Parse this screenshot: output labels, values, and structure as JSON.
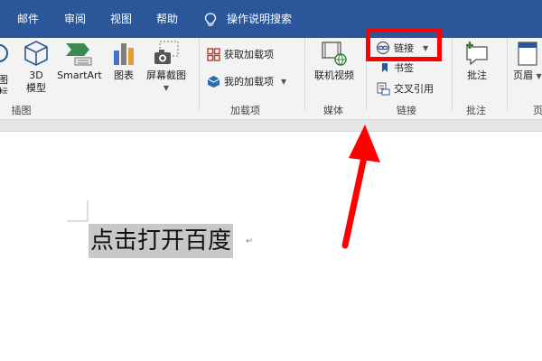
{
  "tabs": [
    {
      "label": "邮件"
    },
    {
      "label": "审阅"
    },
    {
      "label": "视图"
    },
    {
      "label": "帮助"
    }
  ],
  "search": {
    "label": "操作说明搜索"
  },
  "ribbon": {
    "illustrations": {
      "partial_label_top": "图",
      "partial_label_bottom": "标",
      "model3d": "3D\n模型",
      "smartart": "SmartArt",
      "chart": "图表",
      "screenshot": "屏幕截图",
      "group": "插图"
    },
    "addins": {
      "get": "获取加载项",
      "mine": "我的加载项",
      "group": "加载项"
    },
    "media": {
      "video": "联机视频",
      "group": "媒体"
    },
    "links": {
      "link": "链接",
      "bookmark": "书签",
      "crossref": "交叉引用",
      "group": "链接"
    },
    "comments": {
      "comment": "批注",
      "group": "批注"
    },
    "headerfooter": {
      "header_partial": "页眉",
      "group_partial": "页"
    }
  },
  "document": {
    "text": "点击打开百度",
    "para_mark": "↵"
  },
  "colors": {
    "brand": "#2b579a",
    "annotation": "#ff0000"
  }
}
